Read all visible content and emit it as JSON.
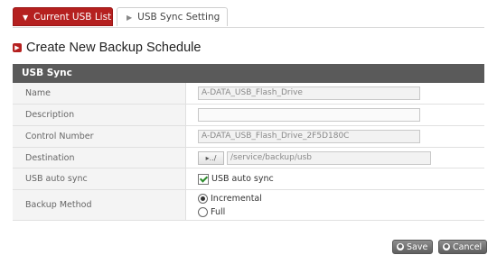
{
  "tabs": [
    {
      "label": "Current USB List",
      "icon": "triangle-down-icon"
    },
    {
      "label": "USB Sync Setting",
      "icon": "triangle-right-icon"
    }
  ],
  "page_title": "Create New Backup Schedule",
  "panel": {
    "header": "USB Sync"
  },
  "fields": {
    "name": {
      "label": "Name",
      "value": "A-DATA_USB_Flash_Drive"
    },
    "description": {
      "label": "Description",
      "value": ""
    },
    "control_number": {
      "label": "Control Number",
      "value": "A-DATA_USB_Flash_Drive_2F5D180C"
    },
    "destination": {
      "label": "Destination",
      "browse_label": "▸../",
      "path": "/service/backup/usb"
    },
    "auto_sync": {
      "label": "USB auto sync",
      "checkbox_label": "USB auto sync",
      "checked": true
    },
    "backup_method": {
      "label": "Backup Method",
      "options": [
        "Incremental",
        "Full"
      ],
      "selected": "Incremental"
    }
  },
  "buttons": {
    "save": "Save",
    "cancel": "Cancel"
  },
  "colors": {
    "accent": "#b5201f",
    "header": "#5a5a5a"
  }
}
